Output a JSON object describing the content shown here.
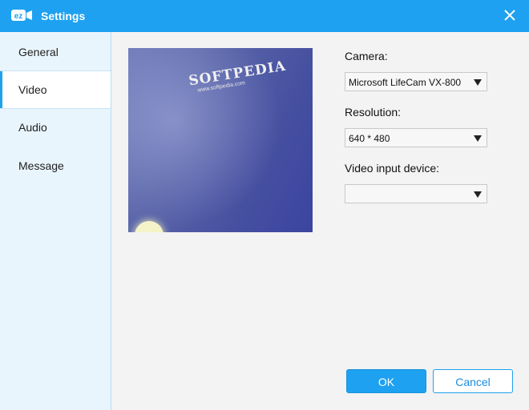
{
  "window": {
    "title": "Settings",
    "logo_text": "ez"
  },
  "sidebar": {
    "items": [
      {
        "label": "General",
        "active": false
      },
      {
        "label": "Video",
        "active": true
      },
      {
        "label": "Audio",
        "active": false
      },
      {
        "label": "Message",
        "active": false
      }
    ]
  },
  "preview": {
    "brand_text": "SOFTPEDIA",
    "url_text": "www.softpedia.com"
  },
  "fields": {
    "camera": {
      "label": "Camera:",
      "value": "Microsoft LifeCam VX-800"
    },
    "resolution": {
      "label": "Resolution:",
      "value": "640 * 480"
    },
    "video_input": {
      "label": "Video input device:",
      "value": ""
    }
  },
  "buttons": {
    "ok": "OK",
    "cancel": "Cancel"
  },
  "colors": {
    "accent": "#1ea1f0",
    "sidebar_bg": "#e9f5fd"
  }
}
